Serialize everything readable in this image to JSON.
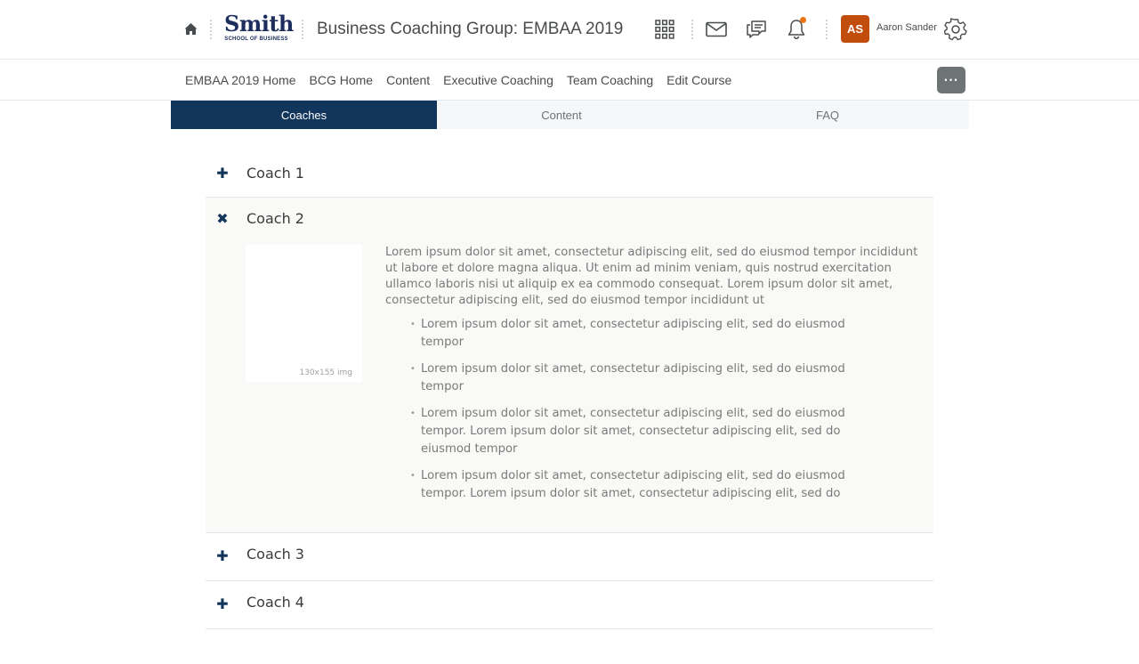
{
  "header": {
    "logo_main": "Smith",
    "logo_sub": "SCHOOL OF BUSINESS",
    "course_title": "Business Coaching Group: EMBAA 2019",
    "avatar_initials": "AS",
    "user_name": "Aaron Sander",
    "accent_color": "#c24c0b",
    "notification_dot_color": "#e87511"
  },
  "nav": {
    "links": [
      "EMBAA 2019 Home",
      "BCG Home",
      "Content",
      "Executive Coaching",
      "Team Coaching",
      "Edit Course"
    ],
    "more_label": "···"
  },
  "tabs": [
    {
      "label": "Coaches",
      "active": true
    },
    {
      "label": "Content",
      "active": false
    },
    {
      "label": "FAQ",
      "active": false
    }
  ],
  "accordion": {
    "items": [
      {
        "title": "Coach 1",
        "open": false
      },
      {
        "title": "Coach 2",
        "open": true
      },
      {
        "title": "Coach 3",
        "open": false
      },
      {
        "title": "Coach 4",
        "open": false
      }
    ],
    "open_body": {
      "image_caption": "130x155 img",
      "paragraph": "Lorem ipsum dolor sit amet, consectetur adipiscing elit, sed do eiusmod tempor incididunt ut labore et dolore magna aliqua. Ut enim ad minim veniam, quis nostrud exercitation ullamco laboris nisi ut aliquip ex ea commodo consequat. Lorem ipsum dolor sit amet, consectetur adipiscing elit, sed do eiusmod tempor incididunt ut",
      "bullets": [
        "Lorem ipsum dolor sit amet, consectetur adipiscing elit, sed do eiusmod tempor",
        "Lorem ipsum dolor sit amet, consectetur adipiscing elit, sed do eiusmod tempor",
        "Lorem ipsum dolor sit amet, consectetur adipiscing elit, sed do eiusmod tempor. Lorem ipsum dolor sit amet, consectetur adipiscing elit, sed do eiusmod tempor",
        "Lorem ipsum dolor sit amet, consectetur adipiscing elit, sed do eiusmod tempor. Lorem ipsum dolor sit amet, consectetur adipiscing elit, sed do"
      ]
    }
  },
  "icons": {
    "home": "home-icon",
    "apps": "grid-icon",
    "mail": "mail-icon",
    "chat": "chat-icon",
    "notifications": "bell-icon",
    "settings": "gear-icon",
    "expand": "plus-icon",
    "collapse": "close-icon"
  },
  "theme": {
    "primary": "#12355b",
    "more_button": "#6e7376"
  }
}
